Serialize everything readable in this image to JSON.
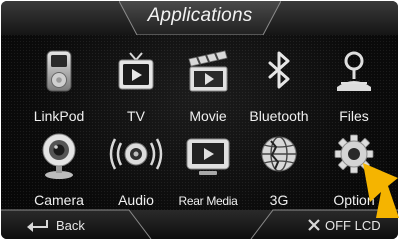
{
  "header": {
    "title": "Applications"
  },
  "apps": [
    {
      "id": "linkpod",
      "label": "LinkPod",
      "icon": "ipod-icon"
    },
    {
      "id": "tv",
      "label": "TV",
      "icon": "tv-icon"
    },
    {
      "id": "movie",
      "label": "Movie",
      "icon": "clapperboard-icon"
    },
    {
      "id": "bluetooth",
      "label": "Bluetooth",
      "icon": "bluetooth-icon"
    },
    {
      "id": "files",
      "label": "Files",
      "icon": "person-icon"
    },
    {
      "id": "camera",
      "label": "Camera",
      "icon": "webcam-icon"
    },
    {
      "id": "audio",
      "label": "Audio",
      "icon": "speaker-icon"
    },
    {
      "id": "rear-media",
      "label": "Rear Media",
      "icon": "monitor-icon"
    },
    {
      "id": "3g",
      "label": "3G",
      "icon": "globe-icon"
    },
    {
      "id": "option",
      "label": "Option",
      "icon": "gear-icon"
    }
  ],
  "footer": {
    "back_label": "Back",
    "off_lcd_label": "OFF LCD"
  },
  "colors": {
    "background": "#0b0b0b",
    "text": "#f0f0f0",
    "pointer_arrow": "#f5b400"
  }
}
